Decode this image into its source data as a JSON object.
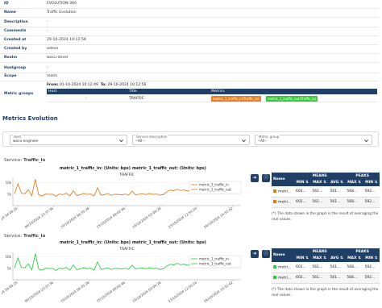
{
  "details": [
    {
      "k": "ID",
      "v": "EVOLUTION-360"
    },
    {
      "k": "Name",
      "v": "Traffic Evolution"
    },
    {
      "k": "Description",
      "v": "-"
    },
    {
      "k": "Comments",
      "v": "-"
    },
    {
      "k": "Created at",
      "v": "29-10-2024 10:12:58"
    },
    {
      "k": "Created by",
      "v": "admin"
    },
    {
      "k": "Realm",
      "v": "wocu-devel"
    },
    {
      "k": "Hostgroup",
      "v": "-"
    },
    {
      "k": "Scope",
      "v": "realm"
    }
  ],
  "metric_groups": {
    "label": "Metric groups",
    "from_label": "From:",
    "from": "01-10-2024 10:12:49",
    "to_label": "To:",
    "to": "29-10-2024 10:12:56",
    "cols": [
      "Host",
      "Title",
      "Metrics"
    ],
    "row": {
      "host": "-",
      "title": "TRAFFIC",
      "m1": "metric_1_traffic_in(Traffic_lo)",
      "m2": "metric_1_traffic_out(Traffic_lo)"
    }
  },
  "evolution": {
    "title": "Metrics Evolution",
    "filters": [
      {
        "label": "Host",
        "value": "wocu-engineer"
      },
      {
        "label": "Service description",
        "value": "--All--"
      },
      {
        "label": "Metric group",
        "value": "--All--"
      }
    ]
  },
  "colors": {
    "navy": "#1f3f66",
    "in": "#e07b20",
    "out": "#2ecc40",
    "tag_in": "#e67e22",
    "tag_out": "#3cc83c"
  },
  "services": [
    {
      "service_prefix": "Service: ",
      "service_name": "Traffic_lo",
      "chart_heading": "metric_1_traffic_in: (Units: bps) metric_1_traffic_out: (Units: bps)",
      "table": {
        "name": "Name",
        "means": "MEANS",
        "peaks": "PEAKS",
        "min": "MIN",
        "max": "MAX",
        "avg": "AVG",
        "rows": [
          {
            "name": "metric_1_traffic_in",
            "disp": "metri...",
            "c": "in",
            "min": "602...",
            "max": "561...",
            "avg": "561...",
            "pmax": "568...",
            "pmin": "592..."
          },
          {
            "name": "metric_1_traffic_out",
            "disp": "metri...",
            "c": "in",
            "min": "602...",
            "max": "561...",
            "avg": "561...",
            "pmax": "568...",
            "pmin": "592..."
          }
        ]
      },
      "note": "(*) The data shown in the graph is the result of averaging the real values."
    },
    {
      "service_prefix": "Service: ",
      "service_name": "Traffic_lo",
      "chart_heading": "metric_1_traffic_in: (Units: bps) metric_1_traffic_out: (Units: bps)",
      "table": {
        "name": "Name",
        "means": "MEANS",
        "peaks": "PEAKS",
        "min": "MIN",
        "max": "MAX",
        "avg": "AVG",
        "rows": [
          {
            "name": "metric_1_traffic_in",
            "disp": "metri...",
            "c": "out",
            "min": "602...",
            "max": "561...",
            "avg": "561...",
            "pmax": "568...",
            "pmin": "592..."
          },
          {
            "name": "metric_1_traffic_out",
            "disp": "metri...",
            "c": "out",
            "min": "602...",
            "max": "561...",
            "avg": "561...",
            "pmax": "568...",
            "pmin": "592..."
          }
        ]
      },
      "note": "(*) The data shown in the graph is the result of averaging the real values."
    }
  ],
  "chart_data": [
    {
      "type": "line",
      "title": "TRAFFIC",
      "y_ticks": [
        "10k",
        "5k"
      ],
      "x_tick_labels": [
        "01/10/2024 04:08:25",
        "06/10/2024 23:37:36",
        "10/10/2024 06:35:28",
        "15/10/2024 08:02:46",
        "19/10/2024 03:09:28",
        "23/10/2024 12:55:24",
        "26/10/2024 16:32:42"
      ],
      "ylim": [
        0,
        12000
      ],
      "series": [
        {
          "name": "metric_1_traffic_in",
          "color": "#e07b20",
          "values": [
            5200,
            9600,
            5400,
            5300,
            7000,
            4300,
            11500,
            4700,
            4200,
            5100,
            4900,
            5000,
            4100,
            5100,
            4800,
            5400,
            4200,
            6500,
            4400,
            4800,
            5300,
            4900,
            5100,
            4200,
            7800,
            4600,
            4800,
            5300,
            4500,
            5000,
            4900,
            4700,
            5100,
            4600,
            6400,
            4700,
            5000,
            5200,
            4800,
            5300,
            4900,
            5100,
            4600,
            4800,
            6000,
            6800,
            6500,
            7200,
            6600,
            6900,
            6300,
            6800,
            7600,
            6900,
            7100,
            6600,
            7300,
            6800,
            7000,
            7400,
            7100,
            6600,
            7200,
            7000,
            6900,
            7300
          ]
        },
        {
          "name": "metric_1_traffic_out",
          "color": "#e07b20",
          "values": [
            5200,
            9600,
            5400,
            5300,
            7000,
            4300,
            11500,
            4700,
            4200,
            5100,
            4900,
            5000,
            4100,
            5100,
            4800,
            5400,
            4200,
            6500,
            4400,
            4800,
            5300,
            4900,
            5100,
            4200,
            7800,
            4600,
            4800,
            5300,
            4500,
            5000,
            4900,
            4700,
            5100,
            4600,
            6400,
            4700,
            5000,
            5200,
            4800,
            5300,
            4900,
            5100,
            4600,
            4800,
            6000,
            6800,
            6500,
            7200,
            6600,
            6900,
            6300,
            6800,
            7600,
            6900,
            7100,
            6600,
            7300,
            6800,
            7000,
            7400,
            7100,
            6600,
            7200,
            7000,
            6900,
            7300
          ]
        }
      ]
    },
    {
      "type": "line",
      "title": "TRAFFIC",
      "y_ticks": [
        "10k",
        "5k"
      ],
      "x_tick_labels": [
        "01/10/2024 04:08:25",
        "06/10/2024 23:37:36",
        "10/10/2024 06:35:28",
        "15/10/2024 08:02:46",
        "19/10/2024 03:09:28",
        "23/10/2024 12:55:24",
        "26/10/2024 16:32:42"
      ],
      "ylim": [
        0,
        12000
      ],
      "series": [
        {
          "name": "metric_1_traffic_in",
          "color": "#2ecc40",
          "values": [
            5200,
            9600,
            5400,
            5300,
            7000,
            4300,
            11500,
            4700,
            4200,
            5100,
            4900,
            5000,
            4100,
            5100,
            4800,
            5400,
            4200,
            6500,
            4400,
            4800,
            5300,
            4900,
            5100,
            4200,
            7800,
            4600,
            4800,
            5300,
            4500,
            5000,
            4900,
            4700,
            5100,
            4600,
            6400,
            4700,
            5000,
            5200,
            4800,
            5300,
            4900,
            5100,
            4600,
            4800,
            6000,
            6800,
            6500,
            7200,
            6600,
            6900,
            6300,
            6800,
            7600,
            6900,
            7100,
            6600,
            7300,
            6800,
            7000,
            7400,
            7100,
            6600,
            7200,
            7000,
            6900,
            7300
          ]
        },
        {
          "name": "metric_1_traffic_out",
          "color": "#2ecc40",
          "values": [
            5200,
            9600,
            5400,
            5300,
            7000,
            4300,
            11500,
            4700,
            4200,
            5100,
            4900,
            5000,
            4100,
            5100,
            4800,
            5400,
            4200,
            6500,
            4400,
            4800,
            5300,
            4900,
            5100,
            4200,
            7800,
            4600,
            4800,
            5300,
            4500,
            5000,
            4900,
            4700,
            5100,
            4600,
            6400,
            4700,
            5000,
            5200,
            4800,
            5300,
            4900,
            5100,
            4600,
            4800,
            6000,
            6800,
            6500,
            7200,
            6600,
            6900,
            6300,
            6800,
            7600,
            6900,
            7100,
            6600,
            7300,
            6800,
            7000,
            7400,
            7100,
            6600,
            7200,
            7000,
            6900,
            7300
          ]
        }
      ]
    }
  ]
}
